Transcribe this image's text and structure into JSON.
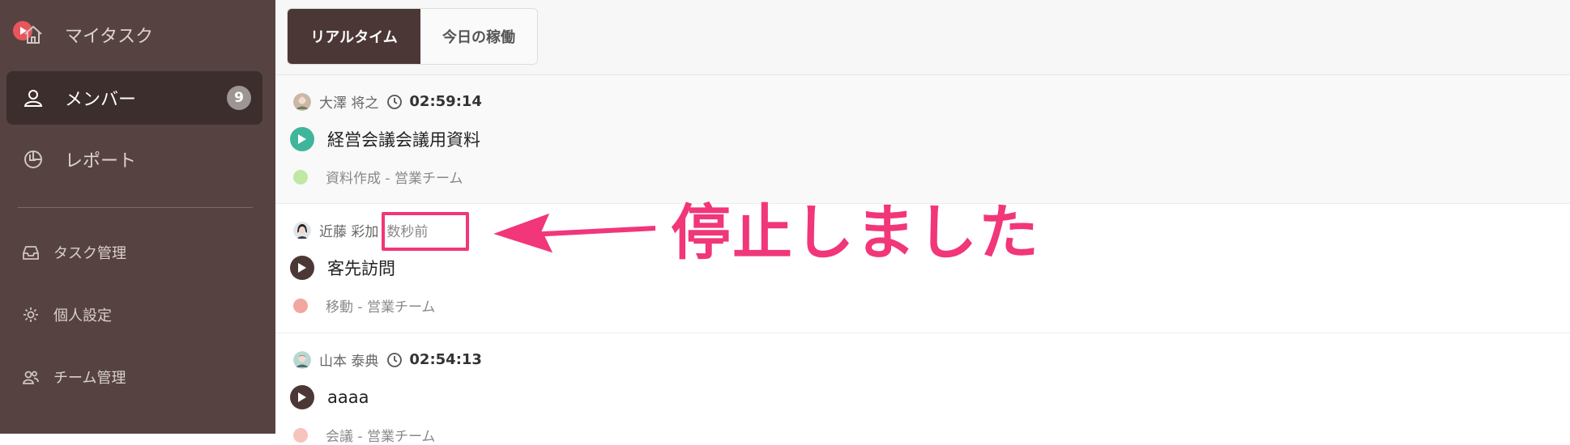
{
  "sidebar": {
    "items": [
      {
        "label": "マイタスク",
        "icon": "home-icon"
      },
      {
        "label": "メンバー",
        "icon": "person-icon",
        "badge": "9",
        "active": true
      },
      {
        "label": "レポート",
        "icon": "pie-chart-icon"
      }
    ],
    "sub_items": [
      {
        "label": "タスク管理",
        "icon": "inbox-icon"
      },
      {
        "label": "個人設定",
        "icon": "gear-icon"
      },
      {
        "label": "チーム管理",
        "icon": "people-icon"
      }
    ]
  },
  "tabs": [
    {
      "label": "リアルタイム",
      "active": true
    },
    {
      "label": "今日の稼働",
      "active": false
    }
  ],
  "entries": [
    {
      "member": "大澤 将之",
      "time": "02:59:14",
      "task": "経営会議会議用資料",
      "project": "資料作成 - 営業チーム",
      "running": true,
      "project_color": "#bfe8a4",
      "play_color": "#3fb59b"
    },
    {
      "member": "近藤 彩加",
      "ago": "数秒前",
      "task": "客先訪問",
      "project": "移動 - 営業チーム",
      "running": false,
      "project_color": "#f1a7a0",
      "play_color": "#4b3836"
    },
    {
      "member": "山本 泰典",
      "time": "02:54:13",
      "task": "aaaa",
      "project": "会議 - 営業チーム",
      "running": false,
      "project_color": "#f6c3bd",
      "play_color": "#4b3836"
    }
  ],
  "annotation": {
    "text": "停止しました",
    "color": "#f1367a"
  }
}
